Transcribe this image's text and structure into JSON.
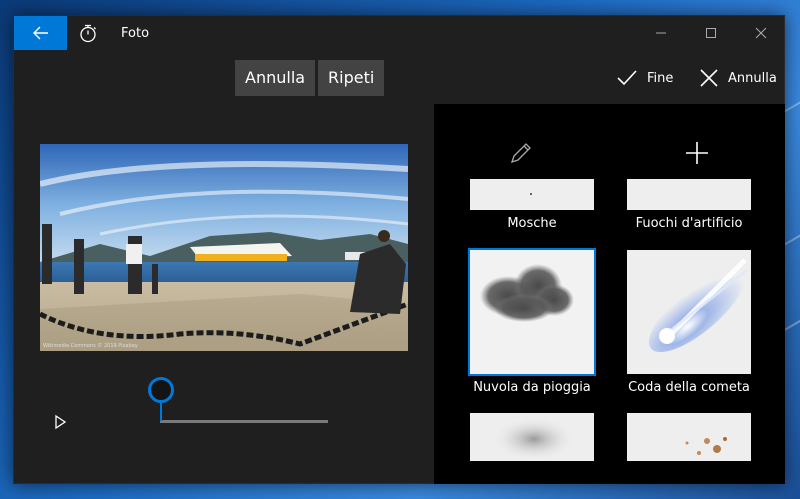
{
  "app": {
    "title": "Foto"
  },
  "toolbar": {
    "undo_label": "Annulla",
    "redo_label": "Ripeti",
    "done_label": "Fine",
    "cancel_label": "Annulla"
  },
  "photo": {
    "caption": "Wikimedia Commons © 2019 Pixabay"
  },
  "playback": {
    "position": 0.0
  },
  "effects": {
    "items": [
      {
        "label": "Mosche"
      },
      {
        "label": "Fuochi d'artificio"
      },
      {
        "label": "Nuvola da pioggia",
        "selected": true
      },
      {
        "label": "Coda della cometa"
      }
    ]
  },
  "colors": {
    "accent": "#0078d7",
    "window_bg": "#1f1f1f",
    "panel_bg": "#000000",
    "button_bg": "#434343"
  }
}
